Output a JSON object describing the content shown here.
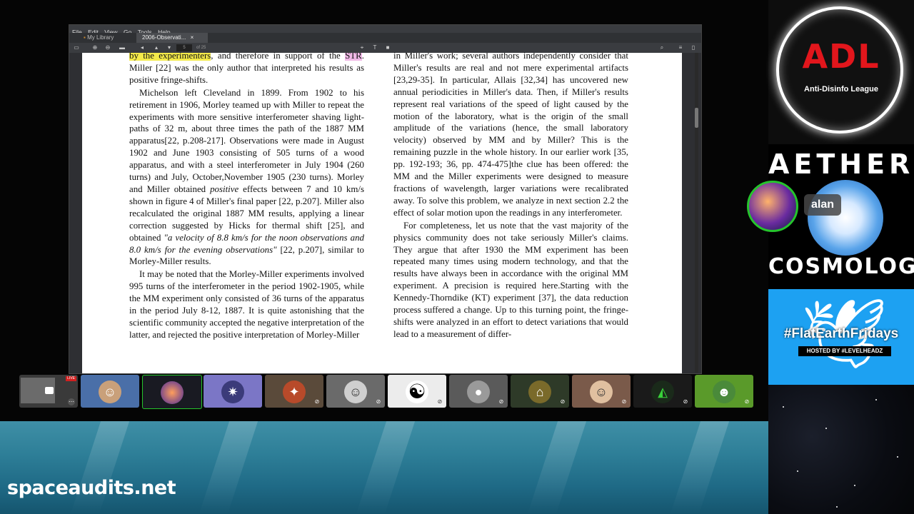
{
  "menu": {
    "file": "File",
    "edit": "Edit",
    "view": "View",
    "go": "Go",
    "tools": "Tools",
    "help": "Help"
  },
  "tabs": [
    {
      "label": "My Library"
    },
    {
      "label": "2006-Observati..."
    }
  ],
  "tab_close": "×",
  "pager": {
    "current": "5",
    "total": "of 25"
  },
  "document": {
    "left_col": {
      "p1_hl": "by the experimenters",
      "p1_rest": ", and therefore in support of the",
      "p1_str": "STR",
      "p1_tail": ". Miller [22] was the only author that interpreted his results as positive fringe-shifts.",
      "p2": "Michelson left Cleveland in 1899. From 1902 to his retirement in 1906, Morley teamed up with Miller to repeat the experiments with more sensitive interferometer shaving light-paths of 32 m, about three times the path of the 1887 MM apparatus[22, p.208-217]. Observations were made in August 1902 and June 1903 consisting of 505 turns of a wood apparatus, and with a steel interferometer in July 1904 (260 turns) and July, October,November 1905 (230 turns). Morley and Miller obtained ",
      "p2_em": "positive",
      "p2_b": " effects between 7 and 10 km/s shown in figure 4 of Miller's final paper [22, p.207]. Miller also recalculated the original 1887 MM results, applying a linear correction suggested by Hicks for thermal shift [25], and obtained ",
      "p2_quote": "\"a velocity of 8.8 km/s for the noon observations and 8.0 km/s for the evening observations\"",
      "p2_c": " [22, p.207], similar to Morley-Miller results.",
      "p3": "It may be noted that the Morley-Miller experiments involved 995 turns of the interferometer in the period 1902-1905, while the MM experiment only consisted of 36 turns of the apparatus in the period July 8-12, 1887. It is quite astonishing that the scientific community accepted the negative interpretation of the latter, and rejected the positive interpretation of Morley-Miller"
    },
    "right_col": {
      "p1": "in Miller's work; several authors independently consider that Miller's results are real and not mere experimental artifacts [23,29-35]. In particular, Allais [32,34] has uncovered new annual periodicities in Miller's data. Then, if Miller's results represent real variations of the speed of light caused by the motion of the laboratory, what is the origin of the small amplitude of the variations (hence, the small laboratory velocity) observed by MM and by Miller? This is the remaining puzzle in the whole history. In our earlier work [35, pp. 192-193; 36, pp. 474-475]the clue has been offered: the MM and the Miller experiments were designed to measure fractions of wavelength, larger variations were recalibrated away. To solve this problem, we analyze in next section 2.2 the effect of solar motion upon the readings in any interferometer.",
      "p2": "For completeness, let us note that the vast majority of the physics community does not take seriously Miller's claims. They argue that after 1930 the MM experiment has been repeated many times using modern technology, and that the results have always been in accordance with the original MM experiment. A precision is required here.Starting with the Kennedy-Thorndike (KT) experiment [37], the data reduction process suffered a change. Up to this turning point, the fringe-shifts were analyzed in an effort to detect variations that would lead to a measurement of differ-"
    }
  },
  "participants": {
    "live_badge": "LIVE",
    "speaker_name": "alan"
  },
  "overlays": {
    "adl_letters": "ADL",
    "adl_sub": "Anti-Disinfo League",
    "aether_top": "AETHER",
    "aether_bottom": "COSMOLOGY",
    "flat_tag": "#FlatEarthFridays",
    "flat_host": "HOSTED BY #LEVELHEADZ",
    "site": "spaceaudits.net"
  },
  "colors": {
    "highlight_yellow": "#f4ea4a",
    "highlight_pink": "#f0b8e6",
    "twitter_blue": "#1da1f2",
    "speaker_ring": "#25c42c",
    "adl_red": "#e2161c"
  }
}
